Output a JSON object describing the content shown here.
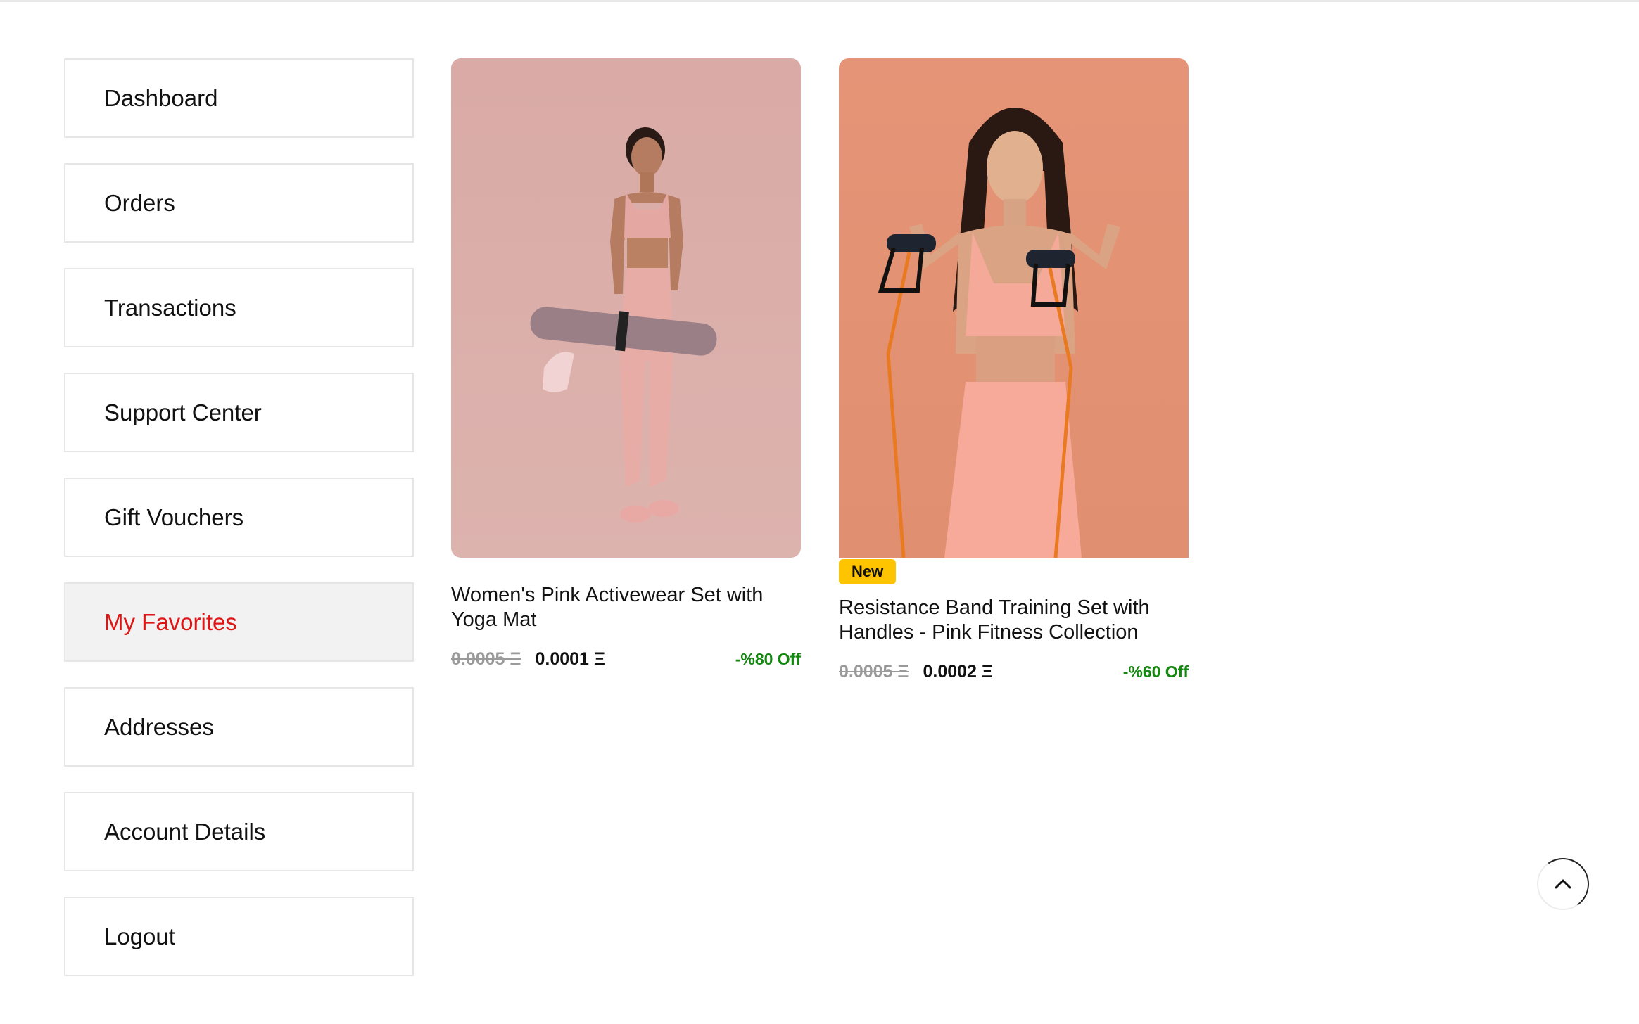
{
  "sidebar": {
    "items": [
      {
        "label": "Dashboard"
      },
      {
        "label": "Orders"
      },
      {
        "label": "Transactions"
      },
      {
        "label": "Support Center"
      },
      {
        "label": "Gift Vouchers"
      },
      {
        "label": "My Favorites",
        "active": true
      },
      {
        "label": "Addresses"
      },
      {
        "label": "Account Details"
      },
      {
        "label": "Logout"
      }
    ]
  },
  "favorites": [
    {
      "title": "Women's Pink Activewear Set with Yoga Mat",
      "old_price": "0.0005 Ξ",
      "price": "0.0001 Ξ",
      "discount": "-%80 Off",
      "image": "woman-pink-activewear-yoga-mat-photo"
    },
    {
      "badge": "New",
      "title": "Resistance Band Training Set with Handles - Pink Fitness Collection",
      "old_price": "0.0005 Ξ",
      "price": "0.0002 Ξ",
      "discount": "-%60 Off",
      "image": "woman-resistance-band-photo"
    }
  ],
  "colors": {
    "active_nav": "#e01515",
    "discount": "#12880f",
    "badge": "#ffc400"
  },
  "icons": {
    "scroll_top": "chevron-up-icon"
  }
}
